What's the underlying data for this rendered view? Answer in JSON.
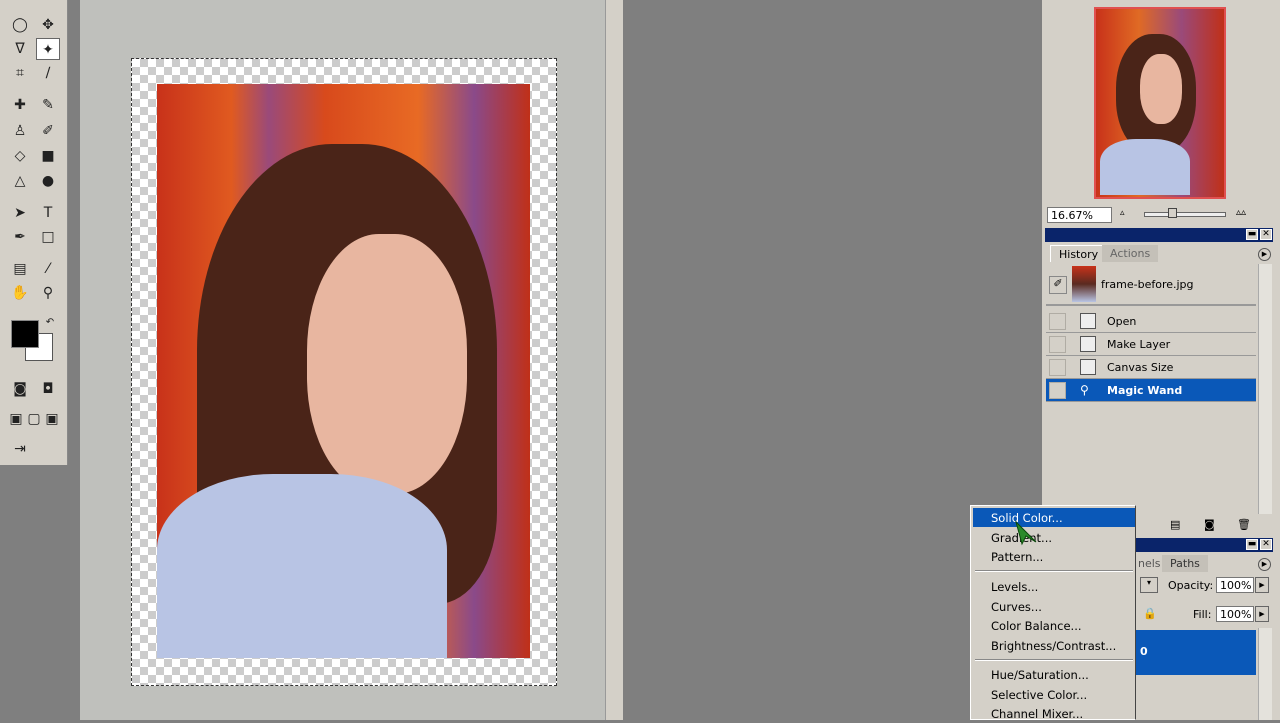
{
  "navigator": {
    "zoom": "16.67%"
  },
  "history": {
    "tabs": [
      "History",
      "Actions"
    ],
    "snapshot": "frame-before.jpg",
    "items": [
      {
        "label": "Open"
      },
      {
        "label": "Make Layer"
      },
      {
        "label": "Canvas Size"
      },
      {
        "label": "Magic Wand",
        "selected": true
      }
    ]
  },
  "layers": {
    "tabs": [
      "nels",
      "Paths"
    ],
    "opacity_label": "Opacity:",
    "opacity": "100%",
    "fill_label": "Fill:",
    "fill": "100%",
    "selected_layer_fragment": "0"
  },
  "menu": {
    "groups": [
      [
        "Solid Color...",
        "Gradient...",
        "Pattern..."
      ],
      [
        "Levels...",
        "Curves...",
        "Color Balance...",
        "Brightness/Contrast..."
      ],
      [
        "Hue/Saturation...",
        "Selective Color...",
        "Channel Mixer..."
      ]
    ],
    "highlighted": "Solid Color..."
  },
  "colors": {
    "selection": "#0a58b8",
    "titlebar": "#0a246a",
    "foreground": "#000000",
    "background": "#ffffff"
  }
}
